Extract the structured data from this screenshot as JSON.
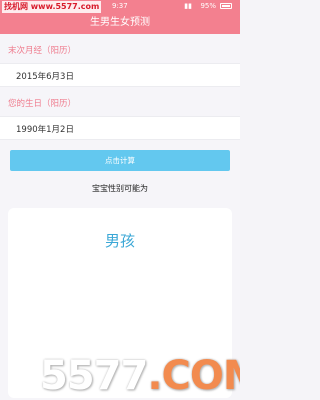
{
  "status_bar": {
    "time": "9:37",
    "battery": "95%"
  },
  "watermark_top": "找机网 www.5577.com",
  "header": {
    "title": "生男生女预测"
  },
  "form": {
    "last_period_label": "末次月经（阳历）",
    "last_period_value": "2015年6月3日",
    "birthday_label": "您的生日（阳历）",
    "birthday_value": "1990年1月2日",
    "calc_button": "点击计算"
  },
  "result": {
    "label": "宝宝性别可能为",
    "value": "男孩"
  },
  "watermark_bottom": {
    "number": "5577",
    "suffix": ".COM"
  }
}
